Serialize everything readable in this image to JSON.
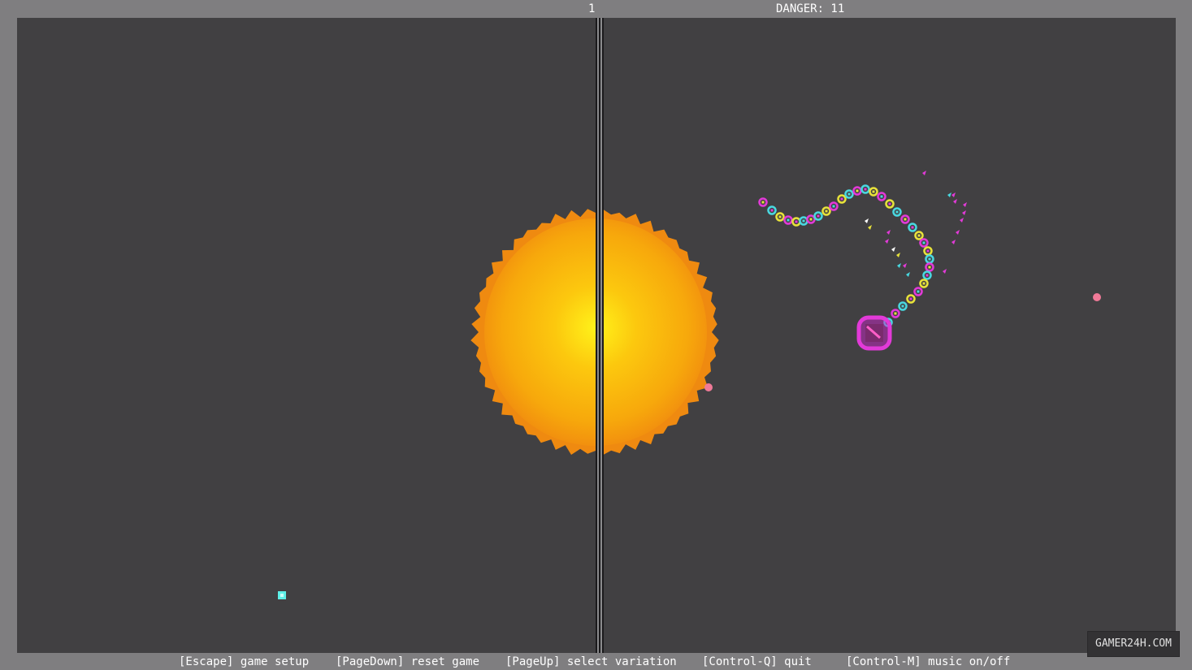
{
  "hud": {
    "score": "1",
    "danger": "DANGER: 11"
  },
  "controls": [
    "[Escape] game setup",
    "[PageDown] reset game",
    "[PageUp] select variation",
    "[Control-Q] quit",
    "[Control-M] music on/off"
  ],
  "watermark": "GAMER24H.COM",
  "colors": {
    "background_frame": "#7f7e80",
    "playfield": "#414042",
    "sun_core": "#ffe81a",
    "sun_edge": "#f08f10",
    "snake_magenta": "#e23ad8",
    "snake_yellow": "#e8e23a",
    "snake_cyan": "#49d8e0",
    "pellet_pink": "#f07a98",
    "gem_cyan": "#5ef0e8"
  },
  "icons": {
    "player_head": "snake-head-icon",
    "food": "pellet-icon",
    "bonus": "gem-icon",
    "hazard": "sun-icon"
  }
}
